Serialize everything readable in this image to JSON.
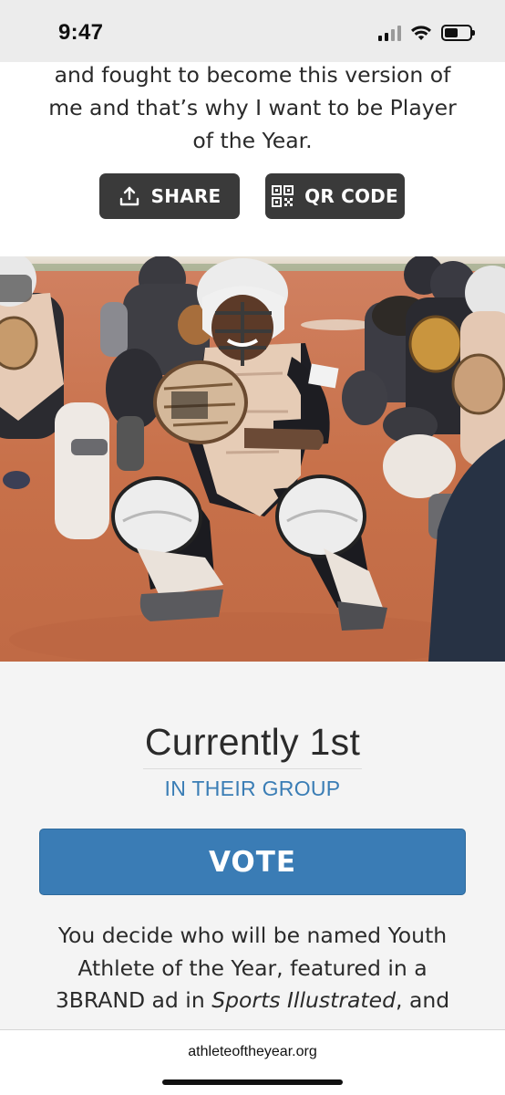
{
  "status_bar": {
    "time": "9:47",
    "signal_bars": 4,
    "signal_active_bars": 2,
    "battery_level": 0.55
  },
  "story": {
    "text": "and fought to become this version of me and that’s why I want to be Player of the Year."
  },
  "actions": {
    "share_label": "SHARE",
    "share_icon": "upload-share-icon",
    "qr_label": "QR CODE",
    "qr_icon": "qr-code-icon"
  },
  "hero": {
    "subject": "youth softball catchers in gear crouching on a clay infield",
    "colors": {
      "clay": "#c8714a",
      "sky": "#e8e2d6"
    }
  },
  "ranking": {
    "title": "Currently 1st",
    "subtitle": "IN THEIR GROUP"
  },
  "vote": {
    "button_label": "VOTE",
    "description_start": "You decide who will be named Youth Athlete of the Year, featured in a 3BRAND ad in ",
    "description_italic": "Sports Illustrated",
    "description_end": ", and"
  },
  "browser": {
    "url": "athleteoftheyear.org"
  },
  "colors": {
    "accent": "#3a7cb5",
    "button_dark": "#3a3a3a",
    "page_background": "#f4f4f4"
  }
}
